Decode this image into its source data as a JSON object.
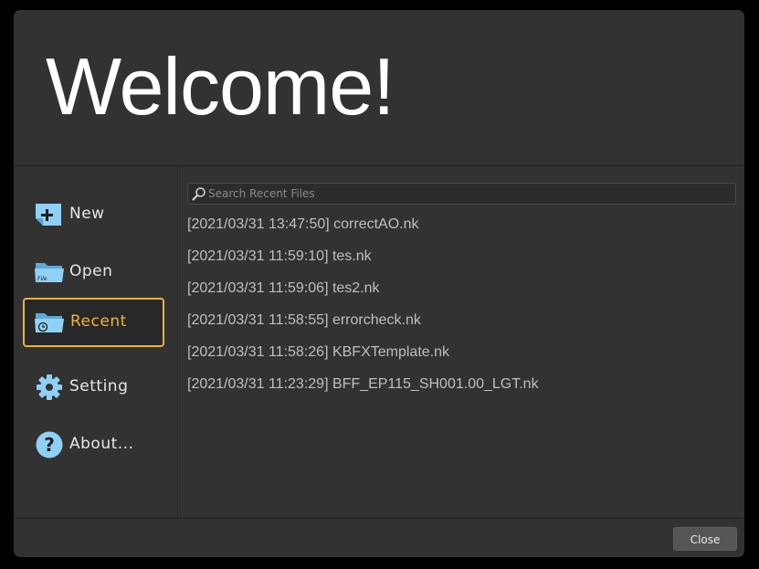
{
  "header": {
    "title": "Welcome!"
  },
  "sidebar": {
    "items": [
      {
        "label": "New",
        "icon": "new-file-icon",
        "active": false
      },
      {
        "label": "Open",
        "icon": "open-folder-icon",
        "active": false
      },
      {
        "label": "Recent",
        "icon": "recent-folder-icon",
        "active": true
      },
      {
        "label": "Setting",
        "icon": "gear-icon",
        "active": false
      },
      {
        "label": "About...",
        "icon": "help-icon",
        "active": false
      }
    ]
  },
  "search": {
    "placeholder": "Search Recent Files",
    "value": ""
  },
  "recent_files": [
    {
      "text": "[2021/03/31 13:47:50] correctAO.nk"
    },
    {
      "text": "[2021/03/31 11:59:10] tes.nk"
    },
    {
      "text": "[2021/03/31 11:59:06] tes2.nk"
    },
    {
      "text": "[2021/03/31 11:58:55] errorcheck.nk"
    },
    {
      "text": "[2021/03/31 11:58:26] KBFXTemplate.nk"
    },
    {
      "text": "[2021/03/31 11:23:29] BFF_EP115_SH001.00_LGT.nk"
    }
  ],
  "footer": {
    "close_label": "Close"
  },
  "colors": {
    "accent": "#e9b23a",
    "background": "#323232",
    "icon_blue": "#7ec4ee"
  }
}
